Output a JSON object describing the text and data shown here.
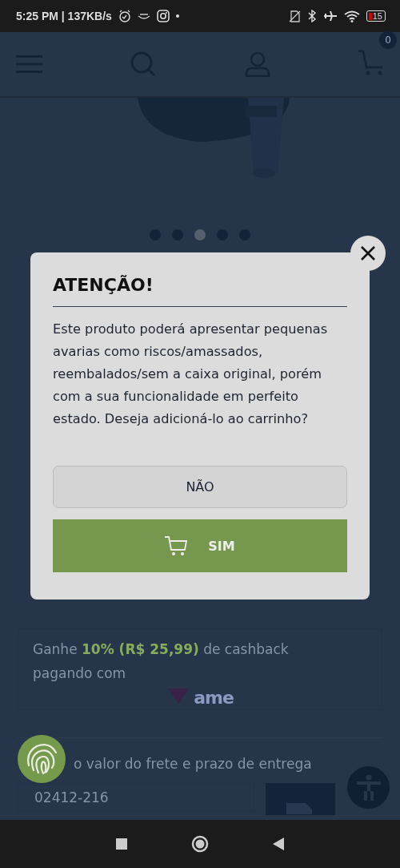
{
  "status_bar": {
    "time": "5:25 PM | 137KB/s",
    "battery": "15"
  },
  "header": {
    "cart_count": "0"
  },
  "carousel": {
    "dots": [
      {
        "selected": false
      },
      {
        "selected": false
      },
      {
        "selected": true
      },
      {
        "selected": false
      },
      {
        "selected": false
      }
    ]
  },
  "modal": {
    "title": "ATENÇÃO!",
    "message": "Este produto poderá apresentar pequenas avarias como riscos/amassados, reembalados/sem a caixa original, porém com a sua funcionalidade em perfeito estado. Deseja adicioná-lo ao carrinho?",
    "buttons": [
      {
        "label": "NÃO",
        "kind": "secondary"
      },
      {
        "label": "SIM",
        "kind": "primary"
      }
    ]
  },
  "cashback": {
    "text": "Ganhe **10% (R$ 25,99)** de cashback pagando com",
    "brand": "ame"
  },
  "shipping": {
    "label": "o valor do frete e prazo de entrega",
    "zip": "02412-216"
  }
}
